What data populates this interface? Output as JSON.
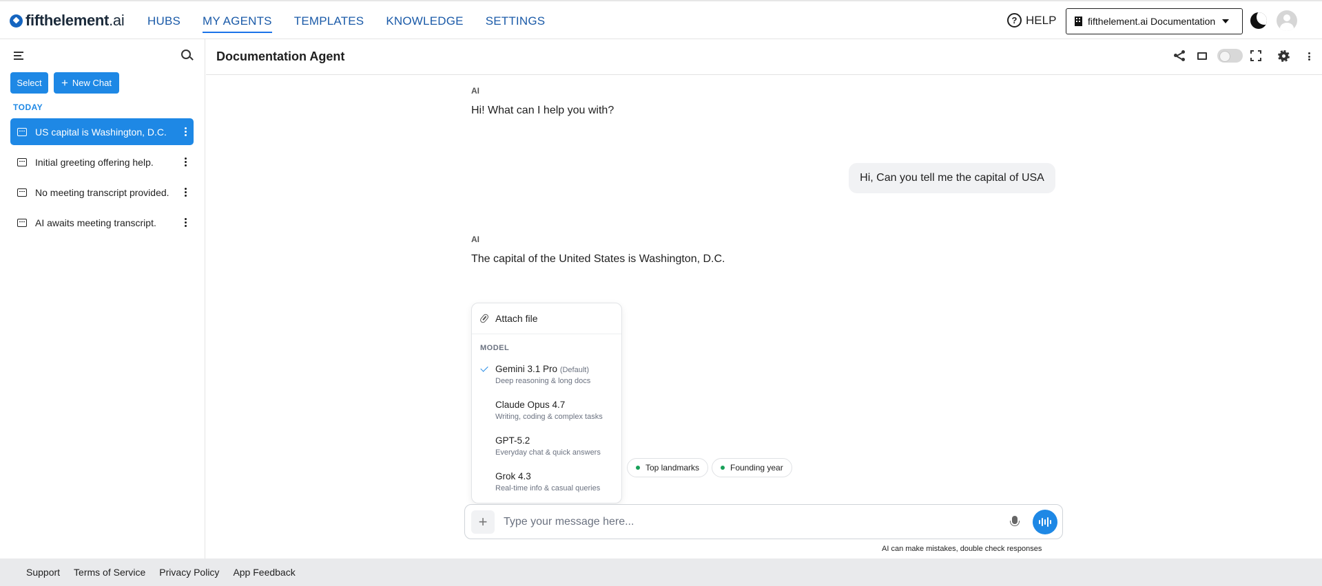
{
  "brand": {
    "name_bold": "fifthelement",
    "name_rest": ".ai"
  },
  "nav": {
    "items": [
      {
        "label": "HUBS"
      },
      {
        "label": "MY AGENTS"
      },
      {
        "label": "TEMPLATES"
      },
      {
        "label": "KNOWLEDGE"
      },
      {
        "label": "SETTINGS"
      }
    ],
    "active": "MY AGENTS"
  },
  "header_right": {
    "help_label": "HELP",
    "help_glyph": "?",
    "org_selector": "fifthelement.ai Documentation"
  },
  "sidebar": {
    "select_label": "Select",
    "new_chat_label": "New Chat",
    "new_chat_glyph": "+",
    "section_label": "TODAY",
    "chats": [
      {
        "label": "US capital is Washington, D.C.",
        "active": true
      },
      {
        "label": "Initial greeting offering help.",
        "active": false
      },
      {
        "label": "No meeting transcript provided.",
        "active": false
      },
      {
        "label": "AI awaits meeting transcript.",
        "active": false
      }
    ]
  },
  "agent": {
    "title": "Documentation Agent"
  },
  "messages": [
    {
      "role_label": "AI",
      "text": "Hi! What can I help you with?"
    },
    {
      "role_label": "",
      "text": "Hi, Can you tell me the capital of USA"
    },
    {
      "role_label": "AI",
      "text": "The capital of the United States is Washington, D.C."
    }
  ],
  "popup": {
    "attach_label": "Attach file",
    "model_heading": "MODEL",
    "models": [
      {
        "name": "Gemini 3.1 Pro",
        "tag": "(Default)",
        "desc": "Deep reasoning & long docs",
        "selected": true
      },
      {
        "name": "Claude Opus 4.7",
        "tag": "",
        "desc": "Writing, coding & complex tasks",
        "selected": false
      },
      {
        "name": "GPT-5.2",
        "tag": "",
        "desc": "Everyday chat & quick answers",
        "selected": false
      },
      {
        "name": "Grok 4.3",
        "tag": "",
        "desc": "Real-time info & casual queries",
        "selected": false
      }
    ]
  },
  "suggestions": [
    {
      "label": "Top landmarks"
    },
    {
      "label": "Founding year"
    }
  ],
  "composer": {
    "plus_glyph": "+",
    "placeholder": "Type your message here...",
    "disclaimer": "AI can make mistakes, double check responses"
  },
  "footer": {
    "links": [
      {
        "label": "Support"
      },
      {
        "label": "Terms of Service"
      },
      {
        "label": "Privacy Policy"
      },
      {
        "label": "App Feedback"
      }
    ]
  },
  "colors": {
    "accent": "#1e88e5",
    "nav_link": "#1a5aa8",
    "chip_dot": "#18a058",
    "footer_bg": "#e9eaec"
  }
}
